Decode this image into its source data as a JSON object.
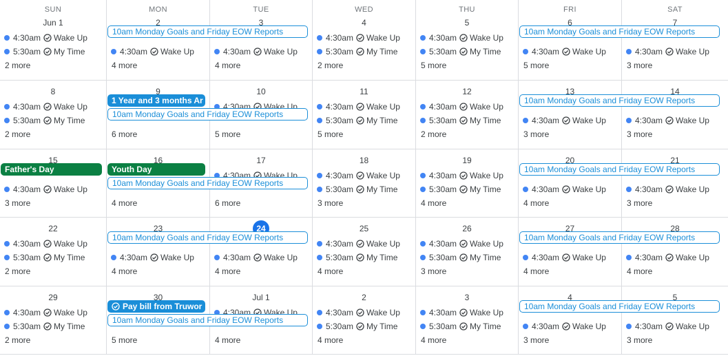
{
  "weekdays": [
    "SUN",
    "MON",
    "TUE",
    "WED",
    "THU",
    "FRI",
    "SAT"
  ],
  "colors": {
    "dot": "#4285f4",
    "outline": "#1a8ed8",
    "green": "#0b8043",
    "today": "#1a73e8"
  },
  "weeks": [
    {
      "days": [
        {
          "date": "Jun 1",
          "slot1": {
            "time": "4:30am",
            "title": "Wake Up",
            "type": "task"
          },
          "slot2": {
            "time": "5:30am",
            "title": "My Time",
            "type": "task"
          },
          "more": "2 more"
        },
        {
          "date": "2",
          "slot2": {
            "time": "4:30am",
            "title": "Wake Up",
            "type": "task"
          },
          "more": "4 more"
        },
        {
          "date": "3",
          "slot2": {
            "time": "4:30am",
            "title": "Wake Up",
            "type": "task"
          },
          "more": "4 more"
        },
        {
          "date": "4",
          "slot1": {
            "time": "4:30am",
            "title": "Wake Up",
            "type": "task"
          },
          "slot2": {
            "time": "5:30am",
            "title": "My Time",
            "type": "task"
          },
          "more": "2 more"
        },
        {
          "date": "5",
          "slot1": {
            "time": "4:30am",
            "title": "Wake Up",
            "type": "task"
          },
          "slot2": {
            "time": "5:30am",
            "title": "My Time",
            "type": "task"
          },
          "more": "5 more"
        },
        {
          "date": "6",
          "slot2": {
            "time": "4:30am",
            "title": "Wake Up",
            "type": "task"
          },
          "more": "5 more"
        },
        {
          "date": "7",
          "slot2": {
            "time": "4:30am",
            "title": "Wake Up",
            "type": "task"
          },
          "more": "3 more"
        }
      ],
      "bars": [
        {
          "label": "10am Monday Goals and Friday EOW Reports",
          "start": 1,
          "span": 2,
          "row": 0,
          "style": "outline"
        },
        {
          "label": "10am Monday Goals and Friday EOW Reports",
          "start": 5,
          "span": 2,
          "row": 0,
          "style": "outline"
        }
      ]
    },
    {
      "days": [
        {
          "date": "8",
          "slot1": {
            "time": "4:30am",
            "title": "Wake Up",
            "type": "task"
          },
          "slot2": {
            "time": "5:30am",
            "title": "My Time",
            "type": "task"
          },
          "more": "2 more"
        },
        {
          "date": "9",
          "more": "6 more"
        },
        {
          "date": "10",
          "slot1": {
            "time": "4:30am",
            "title": "Wake Up",
            "type": "task"
          },
          "more": "5 more"
        },
        {
          "date": "11",
          "slot1": {
            "time": "4:30am",
            "title": "Wake Up",
            "type": "task"
          },
          "slot2": {
            "time": "5:30am",
            "title": "My Time",
            "type": "task"
          },
          "more": "5 more"
        },
        {
          "date": "12",
          "slot1": {
            "time": "4:30am",
            "title": "Wake Up",
            "type": "task"
          },
          "slot2": {
            "time": "5:30am",
            "title": "My Time",
            "type": "task"
          },
          "more": "2 more"
        },
        {
          "date": "13",
          "slot2": {
            "time": "4:30am",
            "title": "Wake Up",
            "type": "task"
          },
          "more": "3 more"
        },
        {
          "date": "14",
          "slot2": {
            "time": "4:30am",
            "title": "Wake Up",
            "type": "task"
          },
          "more": "3 more"
        }
      ],
      "bars": [
        {
          "label": "1 Year and 3 months Ar",
          "start": 1,
          "span": 1,
          "row": 0,
          "style": "blue"
        },
        {
          "label": "10am Monday Goals and Friday EOW Reports",
          "start": 1,
          "span": 2,
          "row": 1,
          "style": "outline"
        },
        {
          "label": "10am Monday Goals and Friday EOW Reports",
          "start": 5,
          "span": 2,
          "row": 0,
          "style": "outline"
        }
      ]
    },
    {
      "days": [
        {
          "date": "15",
          "slot2": {
            "time": "4:30am",
            "title": "Wake Up",
            "type": "task"
          },
          "more": "3 more"
        },
        {
          "date": "16",
          "more": "4 more"
        },
        {
          "date": "17",
          "slot1": {
            "time": "4:30am",
            "title": "Wake Up",
            "type": "task"
          },
          "more": "6 more"
        },
        {
          "date": "18",
          "slot1": {
            "time": "4:30am",
            "title": "Wake Up",
            "type": "task"
          },
          "slot2": {
            "time": "5:30am",
            "title": "My Time",
            "type": "task"
          },
          "more": "3 more"
        },
        {
          "date": "19",
          "slot1": {
            "time": "4:30am",
            "title": "Wake Up",
            "type": "task"
          },
          "slot2": {
            "time": "5:30am",
            "title": "My Time",
            "type": "task"
          },
          "more": "4 more"
        },
        {
          "date": "20",
          "slot2": {
            "time": "4:30am",
            "title": "Wake Up",
            "type": "task"
          },
          "more": "4 more"
        },
        {
          "date": "21",
          "slot2": {
            "time": "4:30am",
            "title": "Wake Up",
            "type": "task"
          },
          "more": "3 more"
        }
      ],
      "bars": [
        {
          "label": "Father's Day",
          "start": 0,
          "span": 1,
          "row": 0,
          "style": "green"
        },
        {
          "label": "Youth Day",
          "start": 1,
          "span": 1,
          "row": 0,
          "style": "green"
        },
        {
          "label": "10am Monday Goals and Friday EOW Reports",
          "start": 1,
          "span": 2,
          "row": 1,
          "style": "outline"
        },
        {
          "label": "10am Monday Goals and Friday EOW Reports",
          "start": 5,
          "span": 2,
          "row": 0,
          "style": "outline"
        }
      ]
    },
    {
      "days": [
        {
          "date": "22",
          "slot1": {
            "time": "4:30am",
            "title": "Wake Up",
            "type": "task"
          },
          "slot2": {
            "time": "5:30am",
            "title": "My Time",
            "type": "task"
          },
          "more": "2 more"
        },
        {
          "date": "23",
          "slot2": {
            "time": "4:30am",
            "title": "Wake Up",
            "type": "task"
          },
          "more": "4 more"
        },
        {
          "date": "24",
          "today": true,
          "slot2": {
            "time": "4:30am",
            "title": "Wake Up",
            "type": "task"
          },
          "more": "4 more"
        },
        {
          "date": "25",
          "slot1": {
            "time": "4:30am",
            "title": "Wake Up",
            "type": "task"
          },
          "slot2": {
            "time": "5:30am",
            "title": "My Time",
            "type": "task"
          },
          "more": "4 more"
        },
        {
          "date": "26",
          "slot1": {
            "time": "4:30am",
            "title": "Wake Up",
            "type": "task"
          },
          "slot2": {
            "time": "5:30am",
            "title": "My Time",
            "type": "task"
          },
          "more": "3 more"
        },
        {
          "date": "27",
          "slot2": {
            "time": "4:30am",
            "title": "Wake Up",
            "type": "task"
          },
          "more": "4 more"
        },
        {
          "date": "28",
          "slot2": {
            "time": "4:30am",
            "title": "Wake Up",
            "type": "task"
          },
          "more": "4 more"
        }
      ],
      "bars": [
        {
          "label": "10am Monday Goals and Friday EOW Reports",
          "start": 1,
          "span": 2,
          "row": 0,
          "style": "outline"
        },
        {
          "label": "10am Monday Goals and Friday EOW Reports",
          "start": 5,
          "span": 2,
          "row": 0,
          "style": "outline"
        }
      ]
    },
    {
      "days": [
        {
          "date": "29",
          "slot1": {
            "time": "4:30am",
            "title": "Wake Up",
            "type": "task"
          },
          "slot2": {
            "time": "5:30am",
            "title": "My Time",
            "type": "task"
          },
          "more": "2 more"
        },
        {
          "date": "30",
          "more": "5 more"
        },
        {
          "date": "Jul 1",
          "slot1": {
            "time": "4:30am",
            "title": "Wake Up",
            "type": "task"
          },
          "more": "4 more"
        },
        {
          "date": "2",
          "slot1": {
            "time": "4:30am",
            "title": "Wake Up",
            "type": "task"
          },
          "slot2": {
            "time": "5:30am",
            "title": "My Time",
            "type": "task"
          },
          "more": "4 more"
        },
        {
          "date": "3",
          "slot1": {
            "time": "4:30am",
            "title": "Wake Up",
            "type": "task"
          },
          "slot2": {
            "time": "5:30am",
            "title": "My Time",
            "type": "task"
          },
          "more": "4 more"
        },
        {
          "date": "4",
          "slot2": {
            "time": "4:30am",
            "title": "Wake Up",
            "type": "task"
          },
          "more": "3 more"
        },
        {
          "date": "5",
          "slot2": {
            "time": "4:30am",
            "title": "Wake Up",
            "type": "task"
          },
          "more": "3 more"
        }
      ],
      "bars": [
        {
          "label": "Pay bill from Truwor",
          "start": 1,
          "span": 1,
          "row": 0,
          "style": "blue",
          "task": true
        },
        {
          "label": "10am Monday Goals and Friday EOW Reports",
          "start": 1,
          "span": 2,
          "row": 1,
          "style": "outline"
        },
        {
          "label": "10am Monday Goals and Friday EOW Reports",
          "start": 5,
          "span": 2,
          "row": 0,
          "style": "outline"
        }
      ]
    }
  ]
}
